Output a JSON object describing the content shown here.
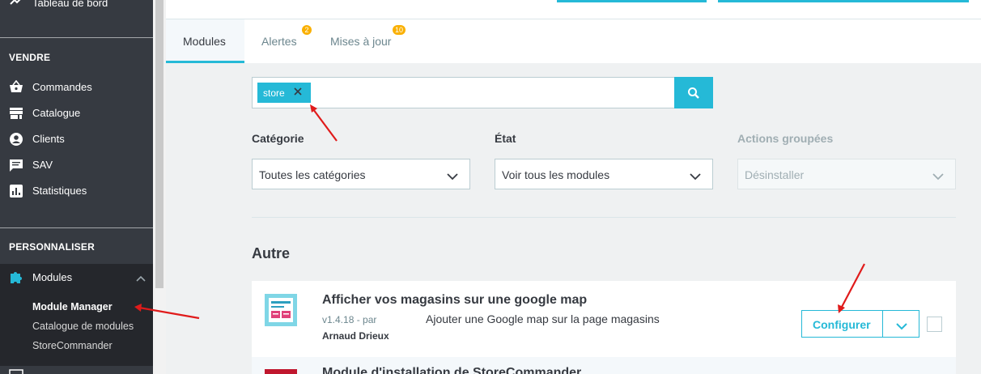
{
  "sidebar": {
    "top_item": "Tableau de bord",
    "section_sell": "VENDRE",
    "sell_items": [
      {
        "label": "Commandes",
        "icon": "basket-icon"
      },
      {
        "label": "Catalogue",
        "icon": "store-icon"
      },
      {
        "label": "Clients",
        "icon": "account-icon"
      },
      {
        "label": "SAV",
        "icon": "chat-icon"
      },
      {
        "label": "Statistiques",
        "icon": "stats-icon"
      }
    ],
    "section_customize": "PERSONNALISER",
    "modules_label": "Modules",
    "modules_sub": [
      "Module Manager",
      "Catalogue de modules",
      "StoreCommander"
    ]
  },
  "tabs": [
    {
      "label": "Modules",
      "badge": ""
    },
    {
      "label": "Alertes",
      "badge": "2"
    },
    {
      "label": "Mises à jour",
      "badge": "10"
    }
  ],
  "search": {
    "chip": "store"
  },
  "filters": {
    "category_label": "Catégorie",
    "category_value": "Toutes les catégories",
    "state_label": "État",
    "state_value": "Voir tous les modules",
    "bulk_label": "Actions groupées",
    "bulk_value": "Désinstaller"
  },
  "group_title": "Autre",
  "module": {
    "name": "Afficher vos magasins sur une google map",
    "version": "v1.4.18 - par",
    "author": "Arnaud Drieux",
    "description": "Ajouter une Google map sur la page magasins",
    "configure_label": "Configurer"
  },
  "module2": {
    "name": "Module d'installation de StoreCommander"
  },
  "colors": {
    "accent": "#25b9d7",
    "sidebar": "#363a41",
    "badge": "#fab000",
    "arrow": "#e01b1b"
  }
}
